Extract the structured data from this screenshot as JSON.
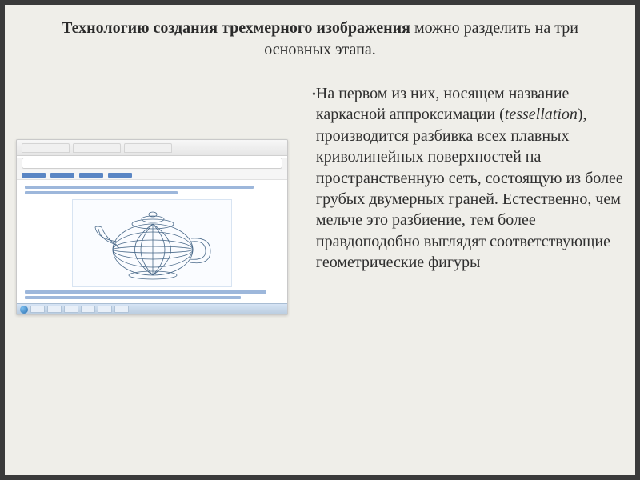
{
  "title": {
    "bold": "Технологию создания трехмерного изображения",
    "rest": " можно разделить на три основных этапа."
  },
  "bullet": "•",
  "body": {
    "pre_italic": "На первом из них, носящем название каркасной аппроксимации (",
    "italic": "tessellation",
    "post_italic": "), производится разбивка всех плавных криволинейных поверхностей на пространственную сеть, состоящую из более грубых двумерных граней. Естественно, чем мельче это разбиение, тем более правдоподобно выглядят соответствующие геометрические фигуры"
  }
}
